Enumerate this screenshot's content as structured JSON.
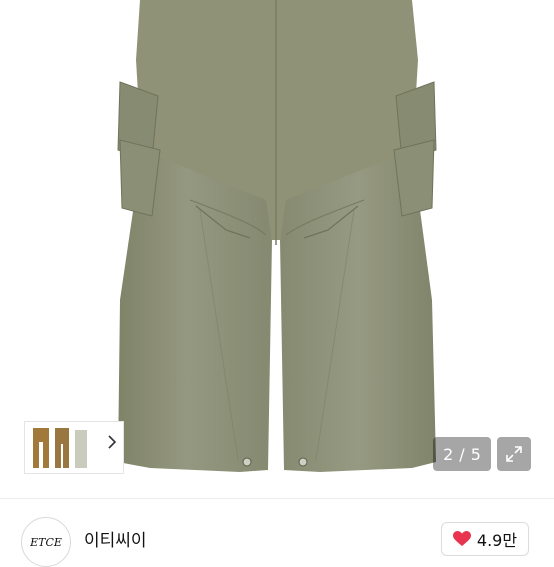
{
  "gallery": {
    "current_page": "2",
    "separator": "/",
    "total_pages": "5",
    "expand_icon": "expand-arrows-icon",
    "thumbnail_arrow_icon": "chevron-right-icon",
    "pants_color": "#8f9276"
  },
  "seller": {
    "logo_text": "ETCE",
    "name": "이티씨이"
  },
  "like": {
    "icon": "heart-icon",
    "icon_color": "#e8344e",
    "count": "4.9만"
  }
}
